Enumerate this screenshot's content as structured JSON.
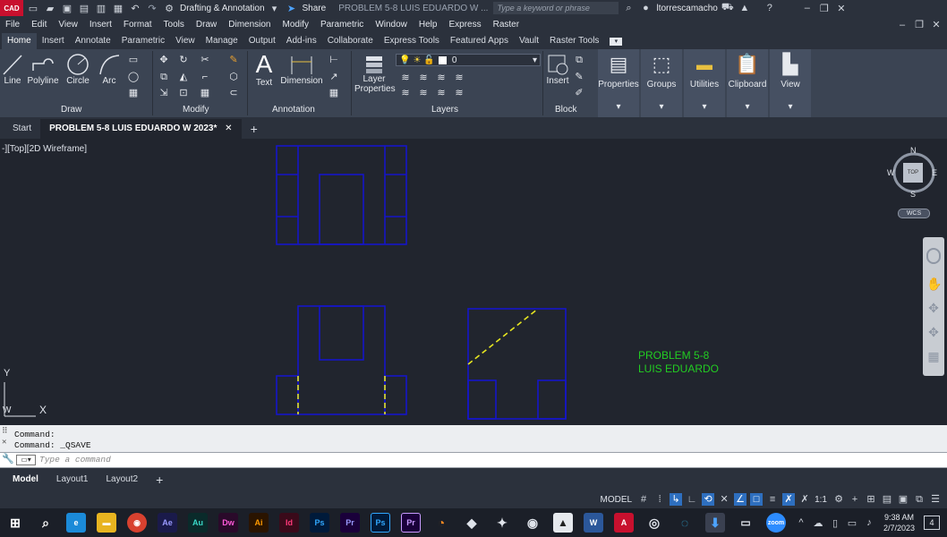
{
  "titlebar": {
    "logo": "CAD",
    "workspace": "Drafting & Annotation",
    "share": "Share",
    "doc_title": "PROBLEM 5-8  LUIS EDUARDO W ...",
    "search_placeholder": "Type a keyword or phrase",
    "user": "ltorrescamacho"
  },
  "menubar": [
    "File",
    "Edit",
    "View",
    "Insert",
    "Format",
    "Tools",
    "Draw",
    "Dimension",
    "Modify",
    "Parametric",
    "Window",
    "Help",
    "Express",
    "Raster"
  ],
  "ribbon_tabs": [
    "Home",
    "Insert",
    "Annotate",
    "Parametric",
    "View",
    "Manage",
    "Output",
    "Add-ins",
    "Collaborate",
    "Express Tools",
    "Featured Apps",
    "Vault",
    "Raster Tools"
  ],
  "ribbon": {
    "draw_tools": [
      "Line",
      "Polyline",
      "Circle",
      "Arc"
    ],
    "text": "Text",
    "dimension": "Dimension",
    "layer_props_1": "Layer",
    "layer_props_2": "Properties",
    "layer_value": "0",
    "insert": "Insert",
    "big_buttons": [
      "Properties",
      "Groups",
      "Utilities",
      "Clipboard",
      "View"
    ],
    "panels": [
      "Draw",
      "Modify",
      "Annotation",
      "Layers",
      "Block"
    ]
  },
  "doc_tabs": {
    "start": "Start",
    "current": "PROBLEM 5-8  LUIS EDUARDO W 2023*",
    "add": "+"
  },
  "viewport": {
    "label": "-][Top][2D Wireframe]",
    "annotation_line1": "PROBLEM 5-8",
    "annotation_line2": "LUIS EDUARDO",
    "annotation_color": "#22cc22",
    "line_color": "#1515c8",
    "hidden_color": "#e6e620",
    "viewcube": {
      "n": "N",
      "s": "S",
      "e": "E",
      "w": "W",
      "face": "TOP",
      "wcs": "WCS"
    },
    "ucs_y": "Y",
    "ucs_x": "X",
    "ucs_w": "W"
  },
  "command": {
    "history": [
      "Command:",
      "Command:  _QSAVE"
    ],
    "placeholder": "Type a command"
  },
  "layout_tabs": [
    "Model",
    "Layout1",
    "Layout2"
  ],
  "status": {
    "model": "MODEL",
    "scale": "1:1"
  },
  "taskbar": {
    "apps": [
      "Ae",
      "Au",
      "Dw",
      "Ai",
      "Id",
      "Ps",
      "Pr",
      "Ps",
      "Pr",
      "W",
      "A"
    ],
    "time": "9:38 AM",
    "date": "2/7/2023",
    "notifications": "4"
  }
}
